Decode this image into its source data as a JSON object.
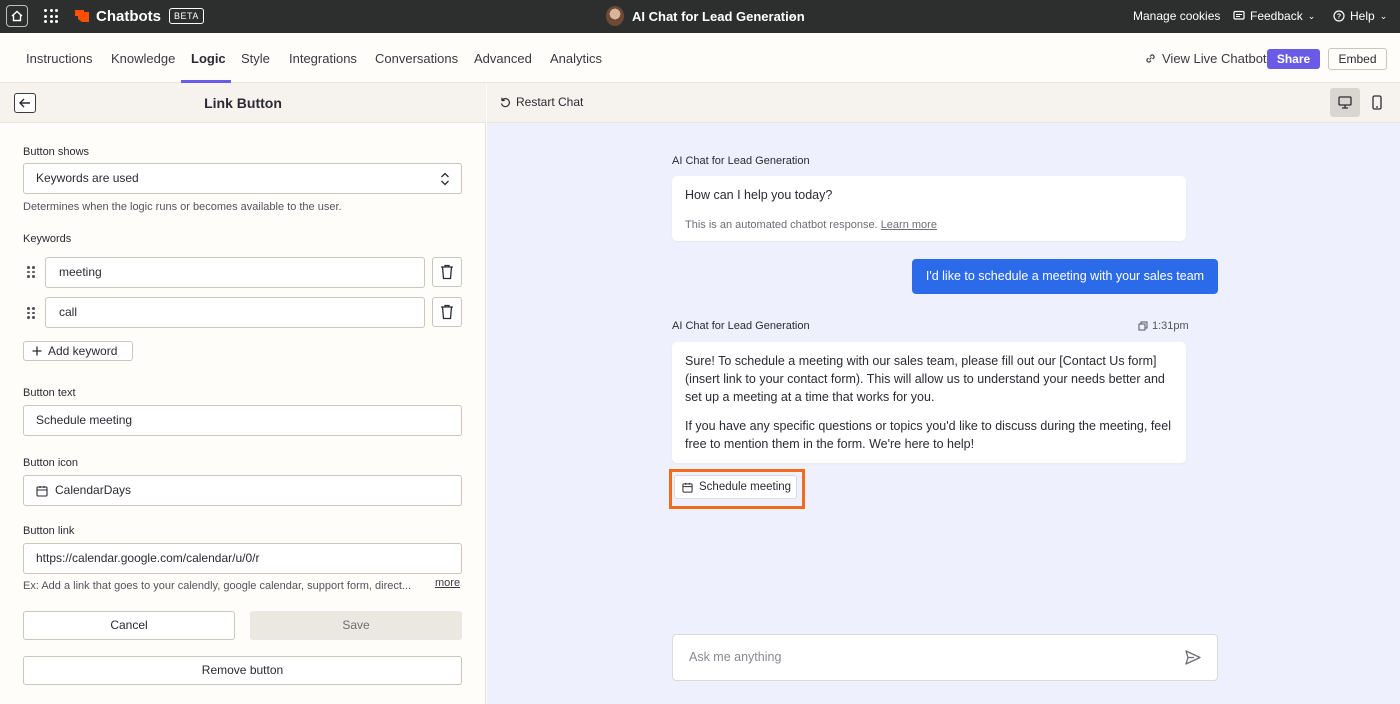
{
  "topbar": {
    "brand": "Chatbots",
    "beta": "BETA",
    "bot_title": "AI Chat for Lead Generation",
    "manage_cookies": "Manage cookies",
    "feedback": "Feedback",
    "help": "Help"
  },
  "tabs": [
    {
      "label": "Instructions"
    },
    {
      "label": "Knowledge"
    },
    {
      "label": "Logic"
    },
    {
      "label": "Style"
    },
    {
      "label": "Integrations"
    },
    {
      "label": "Conversations"
    },
    {
      "label": "Advanced"
    },
    {
      "label": "Analytics"
    }
  ],
  "tabbar": {
    "view_live": "View Live Chatbot",
    "share": "Share",
    "embed": "Embed"
  },
  "left": {
    "title": "Link Button",
    "button_shows_label": "Button shows",
    "button_shows_value": "Keywords are used",
    "button_shows_help": "Determines when the logic runs or becomes available to the user.",
    "keywords_label": "Keywords",
    "keywords": [
      "meeting",
      "call"
    ],
    "add_keyword": "Add keyword",
    "button_text_label": "Button text",
    "button_text_value": "Schedule meeting",
    "button_icon_label": "Button icon",
    "button_icon_value": "CalendarDays",
    "button_link_label": "Button link",
    "button_link_value": "https://calendar.google.com/calendar/u/0/r",
    "button_link_help": "Ex: Add a link that goes to your calendly, google calendar, support form, direct...",
    "more": "more",
    "cancel": "Cancel",
    "save": "Save",
    "remove": "Remove button"
  },
  "chat": {
    "restart": "Restart Chat",
    "bot_name": "AI Chat for Lead Generation",
    "greeting": "How can I help you today?",
    "disclaimer": "This is an automated chatbot response.",
    "learn_more": "Learn more",
    "user_message": "I'd like to schedule a meeting with your sales team",
    "timestamp": "1:31pm",
    "reply_p1": "Sure! To schedule a meeting with our sales team, please fill out our [Contact Us form] (insert link to your contact form). This will allow us to understand your needs better and set up a meeting at a time that works for you.",
    "reply_p2": "If you have any specific questions or topics you'd like to discuss during the meeting, feel free to mention them in the form. We're here to help!",
    "schedule_button": "Schedule meeting",
    "input_placeholder": "Ask me anything"
  },
  "colors": {
    "accent": "#695be8",
    "user_bubble": "#2b6ae8",
    "highlight": "#f26a1b",
    "topbar": "#2d2e2e",
    "chat_bg": "#eef1fd"
  }
}
